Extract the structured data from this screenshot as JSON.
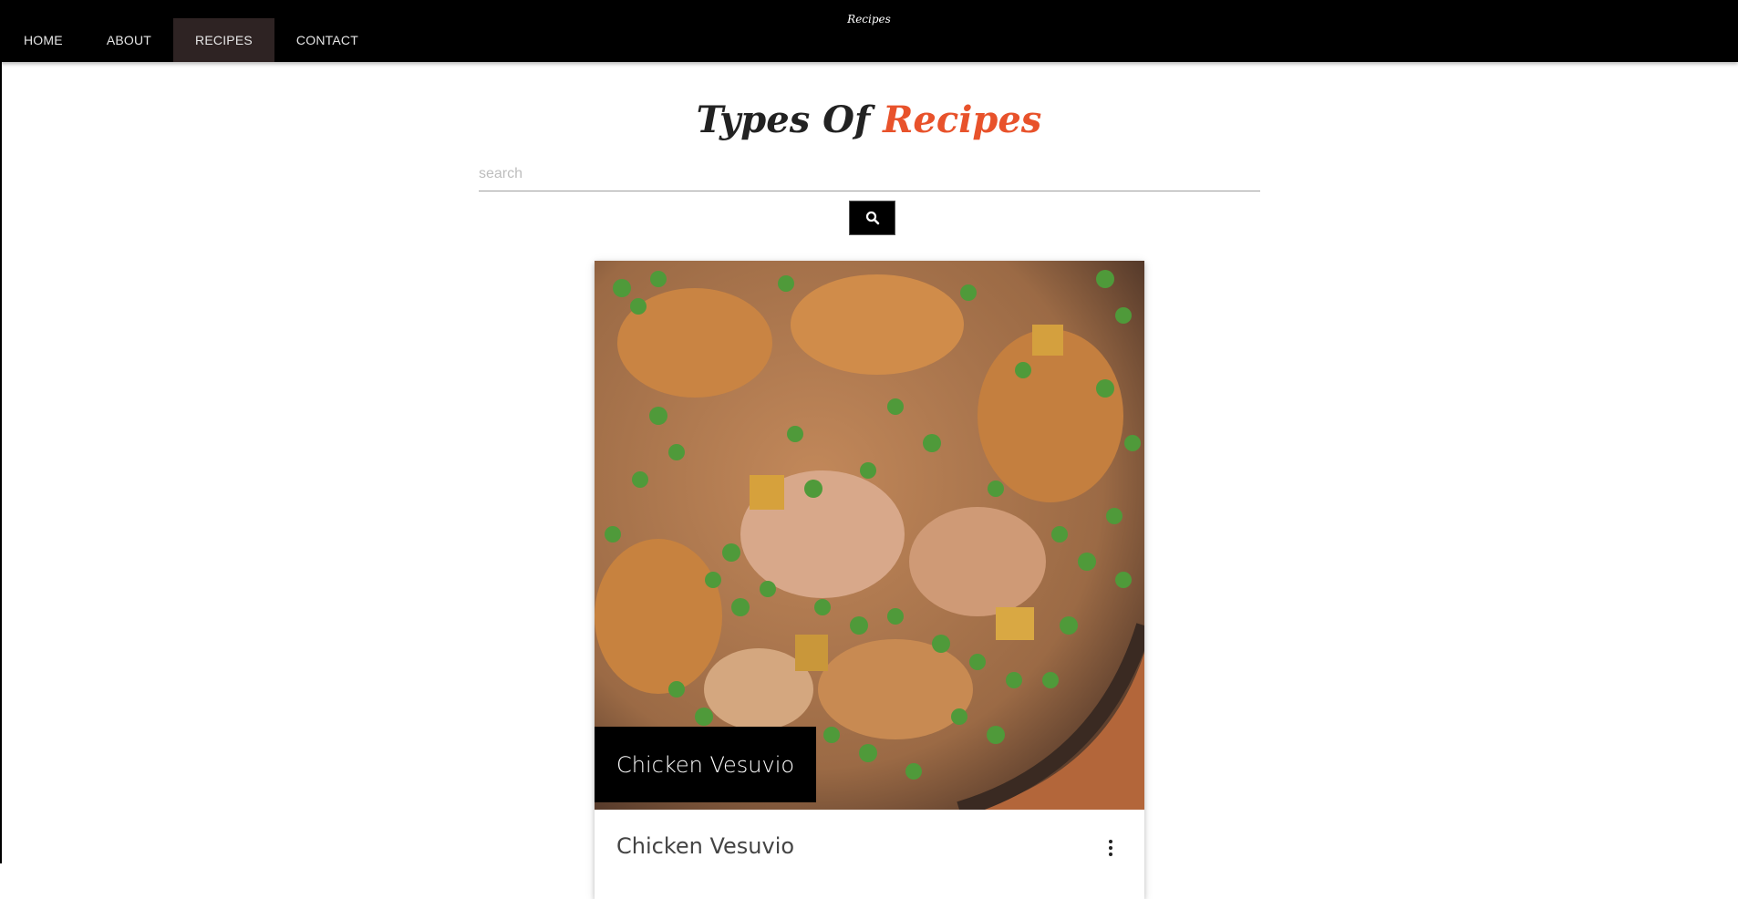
{
  "navbar": {
    "brand": "Recipes",
    "items": [
      {
        "label": "HOME"
      },
      {
        "label": "ABOUT"
      },
      {
        "label": "RECIPES",
        "active": true
      },
      {
        "label": "CONTACT"
      }
    ]
  },
  "page": {
    "title_part1": "Types Of",
    "title_part2": "Recipes"
  },
  "search": {
    "placeholder": "search",
    "value": "",
    "button_icon": "search-icon"
  },
  "card": {
    "image_alt": "Chicken Vesuvio",
    "caption": "Chicken Vesuvio",
    "title": "Chicken Vesuvio",
    "menu_icon": "more-vert-icon"
  },
  "colors": {
    "navbar_bg": "#000000",
    "nav_active_bg": "#2e2323",
    "accent": "#e8522b"
  }
}
